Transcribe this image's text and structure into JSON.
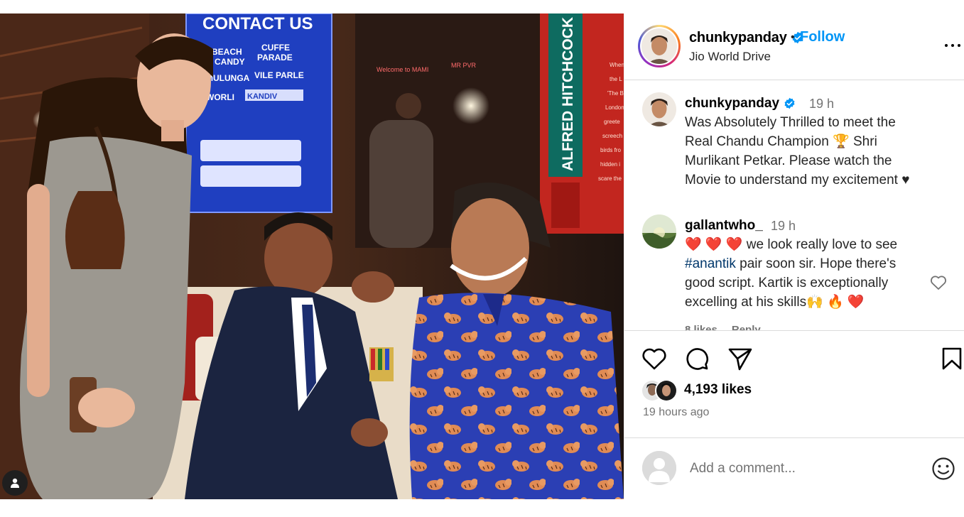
{
  "post": {
    "author": "chunkypanday",
    "follow_label": "Follow",
    "separator": "•",
    "location": "Jio World Drive",
    "photo": {
      "sign_title": "CONTACT US",
      "sign_lines": [
        "BEACH",
        "CANDY",
        "CUFFE",
        "PARADE",
        "MULUNGA",
        "VILE PARLE",
        "WORLI",
        "KANDIV"
      ],
      "banner": "ALFRED HITCHCOCK",
      "neon": [
        "Welcome to MAMI",
        "MR PVR"
      ],
      "wall_text": [
        "When",
        "the L",
        "'The B",
        "London",
        "greete",
        "screech",
        "birds fro",
        "hidden i",
        "scare the"
      ]
    }
  },
  "caption": {
    "username": "chunkypanday",
    "time": "19 h",
    "lines": [
      "Was Absolutely Thrilled to meet the",
      "Real Chandu Champion 🏆 Shri",
      "Murlikant Petkar. Please watch the",
      "Movie to understand my excitement ♥"
    ]
  },
  "comment": {
    "username": "gallantwho_",
    "time": "19 h",
    "line1_emojis": "❤️ ❤️ ❤️",
    "line1_text": " we look really love to see",
    "hashtag": "#anantik",
    "line2_text": " pair soon sir. Hope there's",
    "line3": "good script. Kartik is exceptionally",
    "line4": "excelling at his skills🙌 🔥 ❤️",
    "likes": "8 likes",
    "reply": "Reply"
  },
  "engagement": {
    "likes": "4,193 likes",
    "time_ago": "19 hours ago"
  },
  "add_comment": {
    "placeholder": "Add a comment..."
  },
  "icons": [
    "heart-icon",
    "comment-icon",
    "share-icon",
    "bookmark-icon",
    "more-options-icon",
    "emoji-icon",
    "user-tag-icon",
    "verified-icon"
  ],
  "colors": {
    "accent": "#0095f6",
    "verified": "#0095f6",
    "text_secondary": "#737373",
    "hashtag": "#00376b",
    "border": "#dbdbdb"
  }
}
